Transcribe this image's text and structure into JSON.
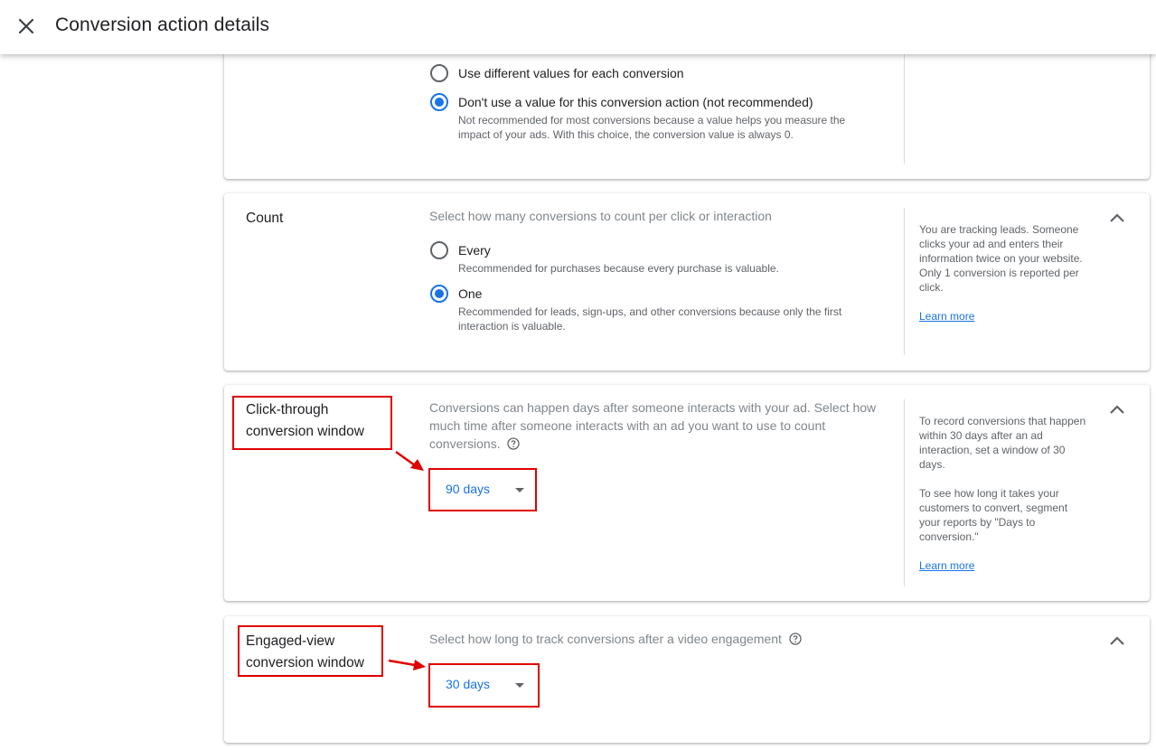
{
  "header": {
    "title": "Conversion action details"
  },
  "value_section": {
    "options": [
      {
        "label": "Use different values for each conversion",
        "selected": false
      },
      {
        "label": "Don't use a value for this conversion action (not recommended)",
        "selected": true,
        "sub": "Not recommended for most conversions because a value helps you measure the impact of your ads. With this choice, the conversion value is always 0."
      }
    ]
  },
  "count_section": {
    "title": "Count",
    "description": "Select how many conversions to count per click or interaction",
    "options": [
      {
        "label": "Every",
        "sub": "Recommended for purchases because every purchase is valuable.",
        "selected": false
      },
      {
        "label": "One",
        "sub": "Recommended for leads, sign-ups, and other conversions because only the first interaction is valuable.",
        "selected": true
      }
    ],
    "side_text": "You are tracking leads. Someone clicks your ad and enters their information twice on your website. Only 1 conversion is reported per click.",
    "learn_more": "Learn more"
  },
  "click_through_section": {
    "title_line1": "Click-through",
    "title_line2": "conversion window",
    "description": "Conversions can happen days after someone interacts with your ad. Select how much time after someone interacts with an ad you want to use to count conversions.",
    "selected_value": "90 days",
    "side_text_1": "To record conversions that happen within 30 days after an ad interaction, set a window of 30 days.",
    "side_text_2": "To see how long it takes your customers to convert, segment your reports by \"Days to conversion.\"",
    "learn_more": "Learn more"
  },
  "engaged_view_section": {
    "title_line1": "Engaged-view",
    "title_line2": "conversion window",
    "description": "Select how long to track conversions after a video engagement",
    "selected_value": "30 days"
  },
  "colors": {
    "accent": "#1a73e8",
    "annotation": "#e00000"
  }
}
